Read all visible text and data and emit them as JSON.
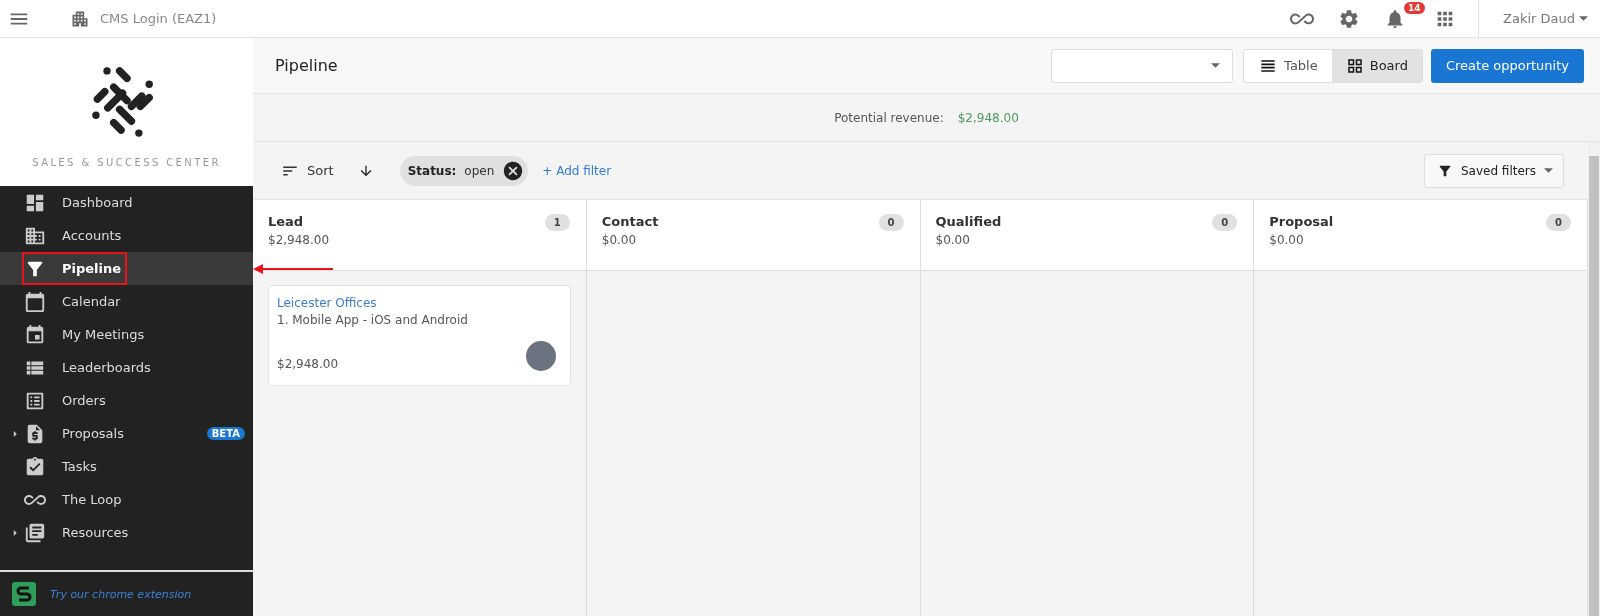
{
  "topbar": {
    "account_name": "CMS Login (EAZ1)",
    "notification_count": "14",
    "user_name": "Zakir Daud"
  },
  "sidebar": {
    "brand": "SALES & SUCCESS CENTER",
    "items": [
      {
        "label": "Dashboard",
        "selected": false,
        "expandable": false,
        "highlighted": false
      },
      {
        "label": "Accounts",
        "selected": false,
        "expandable": false,
        "highlighted": false
      },
      {
        "label": "Pipeline",
        "selected": true,
        "expandable": false,
        "highlighted": true
      },
      {
        "label": "Calendar",
        "selected": false,
        "expandable": false,
        "highlighted": false
      },
      {
        "label": "My Meetings",
        "selected": false,
        "expandable": false,
        "highlighted": false
      },
      {
        "label": "Leaderboards",
        "selected": false,
        "expandable": false,
        "highlighted": false
      },
      {
        "label": "Orders",
        "selected": false,
        "expandable": false,
        "highlighted": false
      },
      {
        "label": "Proposals",
        "selected": false,
        "expandable": true,
        "highlighted": false,
        "badge": "BETA"
      },
      {
        "label": "Tasks",
        "selected": false,
        "expandable": false,
        "highlighted": false
      },
      {
        "label": "The Loop",
        "selected": false,
        "expandable": false,
        "highlighted": false
      },
      {
        "label": "Resources",
        "selected": false,
        "expandable": true,
        "highlighted": false
      }
    ],
    "footer_link": "Try our chrome extension"
  },
  "header": {
    "title": "Pipeline",
    "views": [
      {
        "label": "Table",
        "selected": false
      },
      {
        "label": "Board",
        "selected": true
      }
    ],
    "create_button": "Create opportunity"
  },
  "revenue": {
    "label": "Potential revenue:",
    "value": "$2,948.00"
  },
  "filters": {
    "sort_label": "Sort",
    "chips": [
      {
        "key": "Status:",
        "value": "open"
      }
    ],
    "add_filter": "+ Add filter",
    "saved_filters": "Saved filters"
  },
  "columns": [
    {
      "name": "Lead",
      "total": "$2,948.00",
      "count": "1",
      "cards": [
        {
          "account": "Leicester Offices",
          "title": "1. Mobile App - iOS and Android",
          "amount": "$2,948.00"
        }
      ]
    },
    {
      "name": "Contact",
      "total": "$0.00",
      "count": "0"
    },
    {
      "name": "Qualified",
      "total": "$0.00",
      "count": "0"
    },
    {
      "name": "Proposal",
      "total": "$0.00",
      "count": "0"
    }
  ],
  "annotations": {
    "arrow": true
  }
}
